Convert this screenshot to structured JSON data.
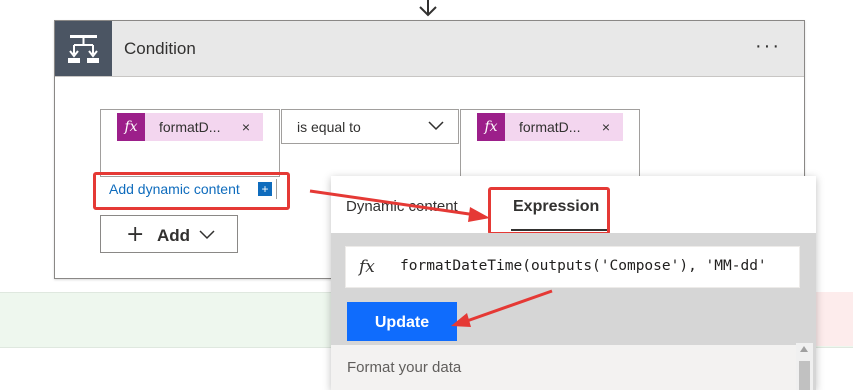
{
  "condition": {
    "title": "Condition",
    "menu_label": "···",
    "left_operand": {
      "token_label": "formatD...",
      "remove_label": "×"
    },
    "operator": {
      "selected": "is equal to"
    },
    "right_operand": {
      "token_label": "formatD...",
      "remove_label": "×"
    },
    "add_dynamic_content": "Add dynamic content",
    "add_dynamic_plus": "+",
    "add_button": {
      "plus": "+",
      "label": "Add"
    }
  },
  "popup": {
    "tabs": [
      {
        "label": "Dynamic content"
      },
      {
        "label": "Expression"
      }
    ],
    "active_tab": "Expression",
    "expression_fx": "fx",
    "expression_text": "formatDateTime(outputs('Compose'), 'MM-dd'",
    "update_label": "Update",
    "format_section_label": "Format your data"
  },
  "tokens": {
    "fx": "fx"
  },
  "icons": {
    "card": "condition-icon",
    "token": "function-icon",
    "dropdown": "chevron-down-icon",
    "top": "arrow-down-icon"
  },
  "colors": {
    "accent_blue": "#0f6cfd",
    "link_blue": "#0f6cbd",
    "token_bg": "#f3d6ef",
    "token_icon": "#9c1f8a",
    "annotation_red": "#e53935",
    "header_bg": "#e8e8e8",
    "icon_box": "#4b5563"
  }
}
